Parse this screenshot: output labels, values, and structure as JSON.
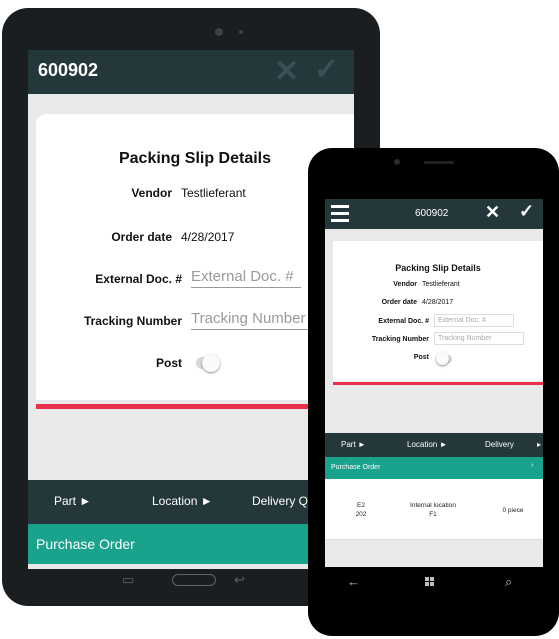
{
  "tablet": {
    "header": {
      "title": "600902",
      "close_icon": "close-icon",
      "confirm_icon": "checkmark-icon"
    },
    "form": {
      "title": "Packing Slip Details",
      "vendor_label": "Vendor",
      "vendor_value": "Testlieferant",
      "order_date_label": "Order date",
      "order_date_value": "4/28/2017",
      "external_doc_label": "External Doc. #",
      "external_doc_placeholder": "External Doc. #",
      "tracking_label": "Tracking Number",
      "tracking_placeholder": "Tracking Number",
      "post_label": "Post",
      "post_value": false
    },
    "tabs": {
      "part": "Part ►",
      "location": "Location ►",
      "delivery": "Delivery Q"
    },
    "section": {
      "purchase_order": "Purchase Order"
    },
    "accent_colors": {
      "header": "#24383c",
      "teal": "#1aa38c",
      "red": "#e8304a"
    }
  },
  "phone": {
    "header": {
      "title": "600902",
      "menu_icon": "hamburger-menu-icon",
      "close_icon": "close-icon",
      "confirm_icon": "checkmark-icon"
    },
    "form": {
      "title": "Packing Slip Details",
      "vendor_label": "Vendor",
      "vendor_value": "Testlieferant",
      "order_date_label": "Order date",
      "order_date_value": "4/28/2017",
      "external_doc_label": "External Doc. #",
      "external_doc_placeholder": "External Doc. #",
      "tracking_label": "Tracking Number",
      "tracking_placeholder": "Tracking Number",
      "post_label": "Post",
      "post_value": false
    },
    "tabs": {
      "part": "Part ►",
      "location": "Location ►",
      "delivery": "Delivery"
    },
    "section": {
      "purchase_order": "Purchase Order"
    },
    "row": {
      "part_line1": "E2",
      "part_line2": "202",
      "location_line1": "Internal location",
      "location_line2": "F1",
      "quantity": "0 piece"
    }
  }
}
